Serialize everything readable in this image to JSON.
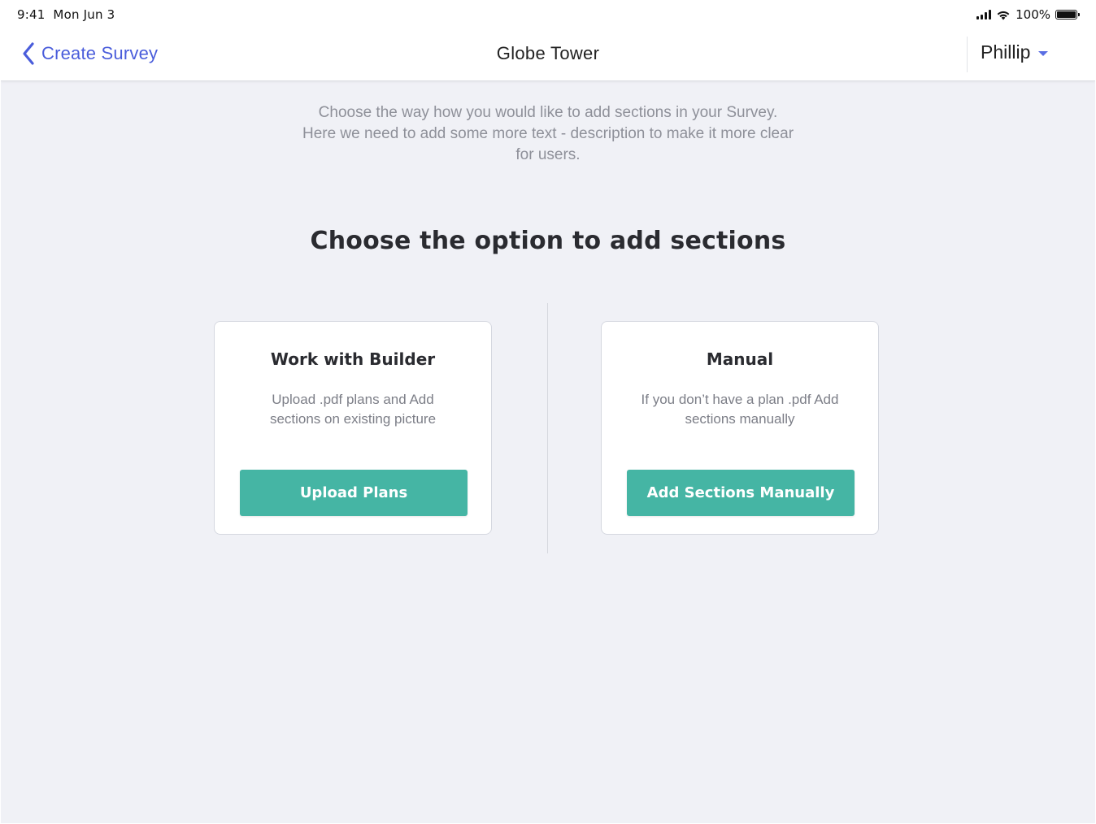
{
  "status_bar": {
    "time": "9:41",
    "date": "Mon Jun 3",
    "battery": "100%",
    "icons": [
      "signal-icon",
      "wifi-icon",
      "battery-icon"
    ]
  },
  "nav": {
    "back_label": "Create Survey",
    "title": "Globe Tower",
    "user_name": "Phillip"
  },
  "intro": {
    "lines": [
      "Choose the way how you would like to add sections in your Survey.",
      "Here we need to add some more text - description to make it more clear",
      "for users."
    ]
  },
  "heading": "Choose the option to add sections",
  "options": [
    {
      "title": "Work with Builder",
      "description_lines": [
        "Upload .pdf plans and Add",
        "sections on existing picture"
      ],
      "button_label": "Upload Plans"
    },
    {
      "title": "Manual",
      "description_lines": [
        "If you don’t have a plan .pdf Add",
        "sections manually"
      ],
      "button_label": "Add Sections Manually"
    }
  ],
  "colors": {
    "accent": "#4a5ddb",
    "button": "#45b5a4",
    "background": "#f0f1f6"
  }
}
